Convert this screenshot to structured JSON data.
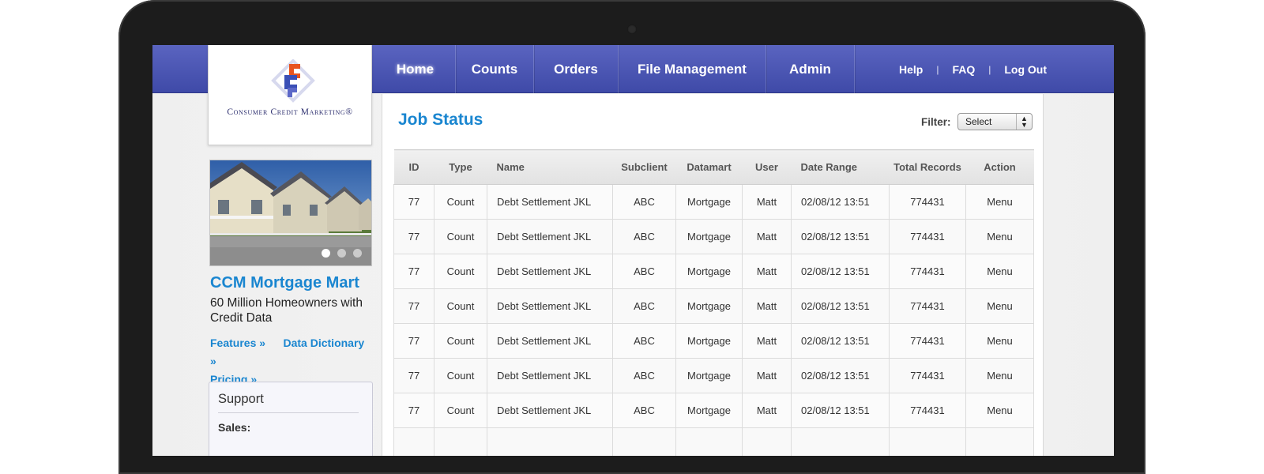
{
  "nav": {
    "items": [
      {
        "label": "Home",
        "active": true
      },
      {
        "label": "Counts",
        "active": false
      },
      {
        "label": "Orders",
        "active": false
      },
      {
        "label": "File Management",
        "active": false
      },
      {
        "label": "Admin",
        "active": false
      }
    ],
    "utility": {
      "help": "Help",
      "faq": "FAQ",
      "logout": "Log Out"
    }
  },
  "logo": {
    "text": "Consumer Credit Marketing®"
  },
  "promo": {
    "title": "CCM Mortgage Mart",
    "description": "60 Million Homeowners with Credit Data",
    "links": {
      "features": "Features »",
      "dictionary": "Data Dictionary »",
      "pricing": "Pricing »"
    },
    "slides": 3,
    "active_slide": 1
  },
  "support": {
    "title": "Support",
    "sales_label": "Sales:"
  },
  "main": {
    "title": "Job Status",
    "filter_label": "Filter:",
    "filter_value": "Select"
  },
  "table": {
    "columns": [
      "ID",
      "Type",
      "Name",
      "Subclient",
      "Datamart",
      "User",
      "Date Range",
      "Total Records",
      "Action"
    ],
    "rows": [
      [
        "77",
        "Count",
        "Debt Settlement JKL",
        "ABC",
        "Mortgage",
        "Matt",
        "02/08/12  13:51",
        "774431",
        "Menu"
      ],
      [
        "77",
        "Count",
        "Debt Settlement JKL",
        "ABC",
        "Mortgage",
        "Matt",
        "02/08/12  13:51",
        "774431",
        "Menu"
      ],
      [
        "77",
        "Count",
        "Debt Settlement JKL",
        "ABC",
        "Mortgage",
        "Matt",
        "02/08/12  13:51",
        "774431",
        "Menu"
      ],
      [
        "77",
        "Count",
        "Debt Settlement JKL",
        "ABC",
        "Mortgage",
        "Matt",
        "02/08/12  13:51",
        "774431",
        "Menu"
      ],
      [
        "77",
        "Count",
        "Debt Settlement JKL",
        "ABC",
        "Mortgage",
        "Matt",
        "02/08/12  13:51",
        "774431",
        "Menu"
      ],
      [
        "77",
        "Count",
        "Debt Settlement JKL",
        "ABC",
        "Mortgage",
        "Matt",
        "02/08/12  13:51",
        "774431",
        "Menu"
      ],
      [
        "77",
        "Count",
        "Debt Settlement JKL",
        "ABC",
        "Mortgage",
        "Matt",
        "02/08/12  13:51",
        "774431",
        "Menu"
      ],
      [
        "",
        "",
        "",
        "",
        "",
        "",
        "",
        "",
        ""
      ]
    ]
  },
  "colors": {
    "nav": "#4a54b4",
    "accent": "#1a86d0"
  }
}
